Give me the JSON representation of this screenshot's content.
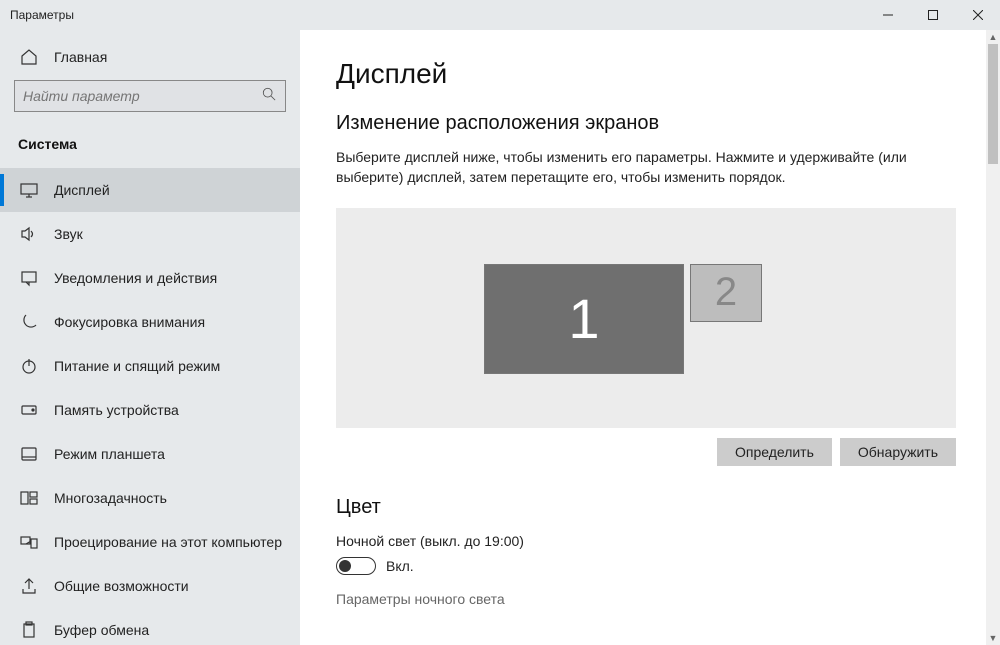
{
  "window": {
    "title": "Параметры"
  },
  "sidebar": {
    "home_label": "Главная",
    "search_placeholder": "Найти параметр",
    "category": "Система",
    "items": [
      {
        "label": "Дисплей",
        "icon": "display",
        "active": true
      },
      {
        "label": "Звук",
        "icon": "sound",
        "active": false
      },
      {
        "label": "Уведомления и действия",
        "icon": "notifications",
        "active": false
      },
      {
        "label": "Фокусировка внимания",
        "icon": "focus",
        "active": false
      },
      {
        "label": "Питание и спящий режим",
        "icon": "power",
        "active": false
      },
      {
        "label": "Память устройства",
        "icon": "storage",
        "active": false
      },
      {
        "label": "Режим планшета",
        "icon": "tablet",
        "active": false
      },
      {
        "label": "Многозадачность",
        "icon": "multitask",
        "active": false
      },
      {
        "label": "Проецирование на этот компьютер",
        "icon": "project",
        "active": false
      },
      {
        "label": "Общие возможности",
        "icon": "shared",
        "active": false
      },
      {
        "label": "Буфер обмена",
        "icon": "clipboard",
        "active": false
      }
    ]
  },
  "page": {
    "title": "Дисплей",
    "arrangement_title": "Изменение расположения экранов",
    "arrangement_desc": "Выберите дисплей ниже, чтобы изменить его параметры. Нажмите и удерживайте (или выберите) дисплей, затем перетащите его, чтобы изменить порядок.",
    "monitor1_label": "1",
    "monitor2_label": "2",
    "identify_btn": "Определить",
    "detect_btn": "Обнаружить",
    "color_section": "Цвет",
    "night_light_label": "Ночной свет (выкл. до 19:00)",
    "toggle_text": "Вкл.",
    "night_light_settings": "Параметры ночного света"
  }
}
